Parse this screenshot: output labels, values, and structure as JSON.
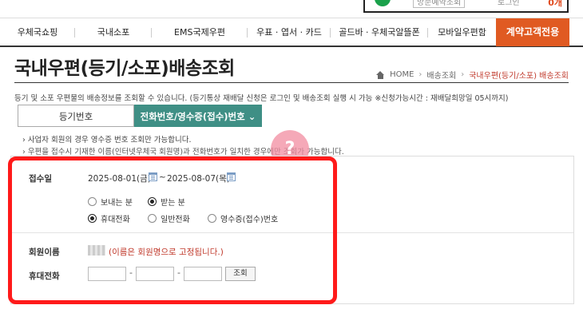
{
  "top_strip": {
    "link1": "방문예약조회",
    "link2": "로그인",
    "badge": "0개"
  },
  "nav": {
    "items": [
      {
        "label": "우체국쇼핑"
      },
      {
        "label": "국내소포"
      },
      {
        "label": "EMS국제우편"
      },
      {
        "label": "우표 · 엽서 · 카드"
      },
      {
        "label": "골드바 · 우체국알뜰폰"
      },
      {
        "label": "모바일우편함"
      },
      {
        "label": "계약고객전용"
      }
    ]
  },
  "page": {
    "title": "국내우편(등기/소포)배송조회",
    "breadcrumb": {
      "home": "HOME",
      "level1": "배송조회",
      "current": "국내우편(등기/소포) 배송조회"
    },
    "description": "등기 및 소포 우편물의 배송정보를 조회할 수 있습니다. (등기통상 재배달 신청은 로그인 및 배송조회 실행 시 가능 ※신청가능시간 : 재배달희망일 05시까지)"
  },
  "tabs": {
    "registered": "등기번호",
    "phone": "전화번호/영수증(접수)번호"
  },
  "notes": {
    "note1": "› 사업자 회원의 경우 영수증 번호 조회만 가능합니다.",
    "note2": "› 우편을 접수시 기재한 이름(인터넷우체국 회원명)과 전화번호가 일치한 경우에만 조회가 가능합니다."
  },
  "overlay_mark": "?",
  "form": {
    "date_label": "접수일",
    "date_from": "2025-08-01(금)",
    "date_tilde": "~",
    "date_to": "2025-08-07(목)",
    "sender_radio": "보내는 분",
    "receiver_radio": "받는 분",
    "mobile_radio": "휴대전화",
    "landline_radio": "일반전화",
    "receipt_radio": "영수증(접수)번호",
    "member_label": "회원이름",
    "member_note": "(이름은 회원명으로 고정됩니다.)",
    "phone_label": "휴대전화",
    "dash": "-",
    "search_button": "조회"
  }
}
